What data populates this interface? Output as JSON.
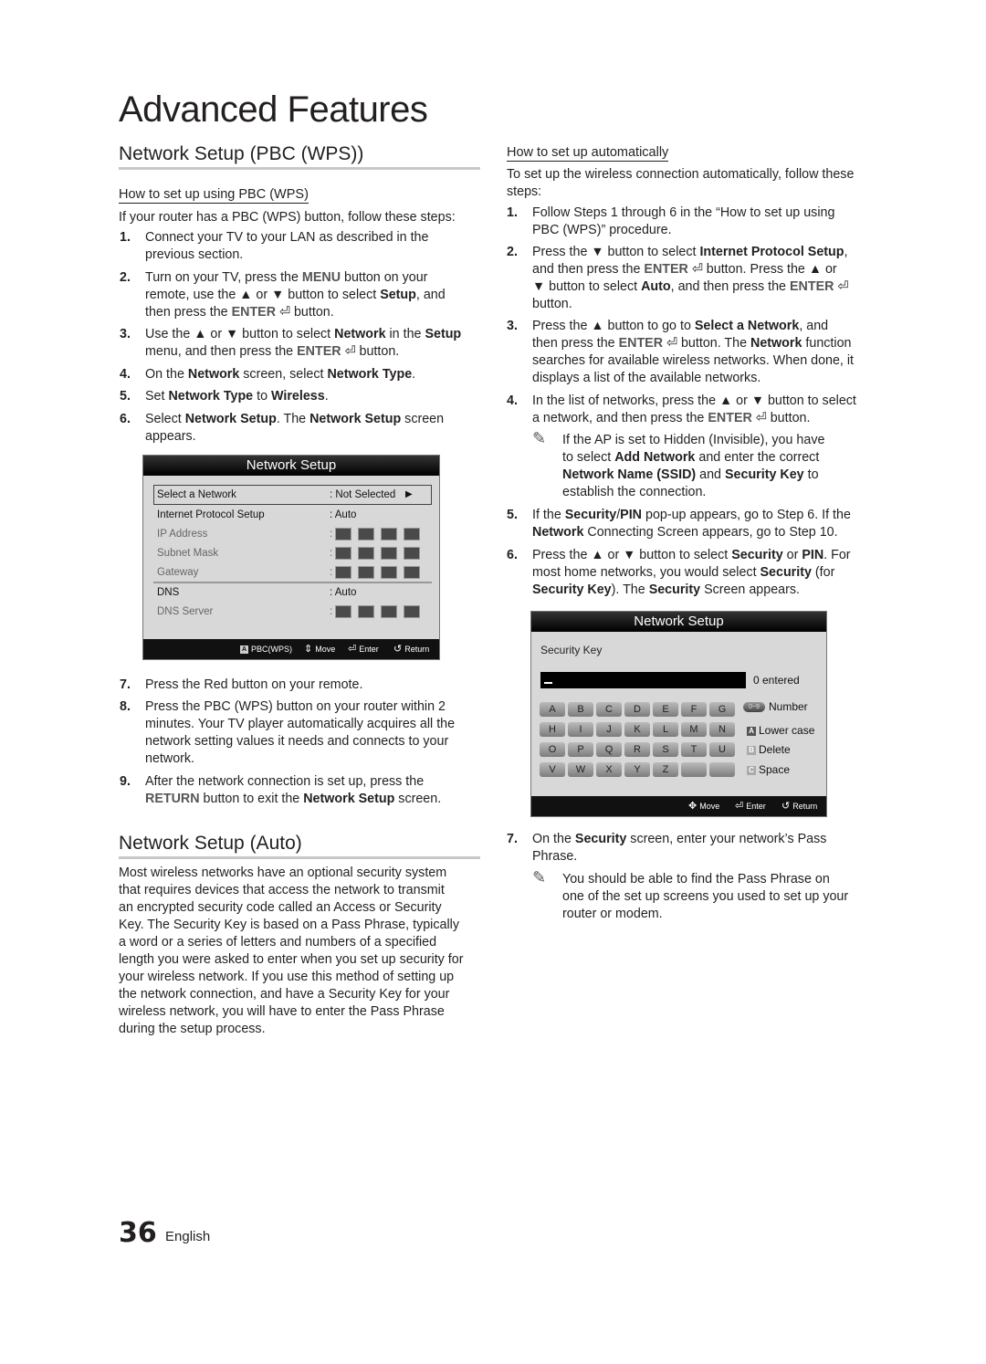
{
  "page": {
    "title": "Advanced Features",
    "number": "36",
    "language": "English"
  },
  "left": {
    "pbc_section": {
      "title": "Network Setup (PBC (WPS))",
      "subtitle": "How to set up using PBC (WPS)",
      "intro": "If your router has a PBC (WPS) button, follow these steps:",
      "steps": [
        {
          "num": "1.",
          "lines": [
            "Connect your TV to your LAN as described in the",
            "previous section."
          ]
        },
        {
          "num": "2.",
          "lines": [
            "Turn on your TV, press the MENU button on your",
            "remote, use the ▲ or ▼ button to select Setup, and",
            "then press the ENTER ⏎ button."
          ]
        },
        {
          "num": "3.",
          "lines": [
            "Use the ▲ or ▼ button to select Network in the Setup",
            "menu, and then press the ENTER ⏎ button."
          ]
        },
        {
          "num": "4.",
          "lines": [
            "On the Network screen, select Network Type."
          ]
        },
        {
          "num": "5.",
          "lines": [
            "Set Network Type to Wireless."
          ]
        },
        {
          "num": "6.",
          "lines": [
            "Select Network Setup. The Network Setup screen",
            "appears."
          ]
        },
        {
          "num": "7.",
          "lines": [
            "Press the Red button on your remote."
          ]
        },
        {
          "num": "8.",
          "lines": [
            "Press the PBC (WPS) button on your router within 2",
            "minutes. Your TV player automatically acquires all the",
            "network setting values it needs and connects to your",
            "network."
          ]
        },
        {
          "num": "9.",
          "lines": [
            "After the network connection is set up, press the",
            "RETURN button to exit the Network Setup screen."
          ]
        }
      ]
    },
    "screen1": {
      "title": "Network Setup",
      "rows": [
        {
          "label": "Select a Network",
          "value": ": Not Selected",
          "arrow": "▶",
          "selected": true,
          "dim": false
        },
        {
          "label": "Internet Protocol Setup",
          "value": ": Auto",
          "dim": false
        },
        {
          "label": "IP Address",
          "value": ":",
          "boxes": 4,
          "dim": true
        },
        {
          "label": "Subnet Mask",
          "value": ":",
          "boxes": 4,
          "dim": true
        },
        {
          "label": "Gateway",
          "value": ":",
          "boxes": 4,
          "dim": true
        },
        {
          "label": "DNS",
          "value": ": Auto",
          "dim": false
        },
        {
          "label": "DNS Server",
          "value": ":",
          "boxes": 4,
          "dim": true
        }
      ],
      "footer": [
        {
          "key": "A",
          "label": "PBC(WPS)"
        },
        {
          "icon": "up-down-arrow-icon",
          "glyph": "⇕",
          "label": "Move"
        },
        {
          "icon": "enter-icon",
          "glyph": "⏎",
          "label": "Enter"
        },
        {
          "icon": "return-icon",
          "glyph": "↺",
          "label": "Return"
        }
      ]
    },
    "auto_section": {
      "title": "Network Setup (Auto)",
      "body_lines": [
        "Most wireless networks have an optional security system",
        "that requires devices that access the network to transmit",
        "an encrypted security code called an Access or Security",
        "Key. The Security Key is based on a Pass Phrase, typically",
        "a word or a series of letters and numbers of a specified",
        "length you were asked to enter when you set up security for",
        "your wireless network.  If you use this method of setting up",
        "the network connection, and have a Security Key for your",
        "wireless network, you will have to enter the Pass Phrase",
        "during the setup process."
      ]
    }
  },
  "right": {
    "auto_howto": {
      "subtitle": "How to set up automatically",
      "intro_lines": [
        "To set up the wireless connection automatically, follow these",
        "steps:"
      ],
      "steps": [
        {
          "num": "1.",
          "lines": [
            "Follow Steps 1 through 6 in the “How to set up using",
            "PBC (WPS)” procedure."
          ]
        },
        {
          "num": "2.",
          "lines": [
            "Press the ▼ button to select Internet Protocol Setup,",
            "and then press the ENTER ⏎ button. Press the ▲ or",
            "▼ button to select Auto, and then press the ENTER ⏎",
            "button."
          ]
        },
        {
          "num": "3.",
          "lines": [
            "Press the ▲ button to go to Select a Network, and",
            "then press the ENTER ⏎ button. The Network function",
            "searches for available wireless networks. When done, it",
            "displays a list of the available networks."
          ]
        },
        {
          "num": "4.",
          "lines": [
            "In the list of networks, press the ▲ or ▼ button to select",
            "a network, and then press the ENTER ⏎ button."
          ]
        },
        {
          "num": "5.",
          "lines": [
            "If the Security/PIN pop-up appears, go to Step 6. If the",
            "Network Connecting Screen appears, go to Step 10."
          ]
        },
        {
          "num": "6.",
          "lines": [
            "Press the ▲ or ▼ button to select Security or PIN. For",
            "most home networks, you would select Security (for",
            "Security Key). The Security Screen appears."
          ]
        },
        {
          "num": "7.",
          "lines": [
            "On the Security screen, enter your network’s Pass",
            "Phrase."
          ]
        }
      ],
      "note_step4": [
        "If the AP is set to Hidden (Invisible), you have",
        "to select Add Network and enter the correct",
        "Network Name (SSID) and Security Key to",
        "establish the connection."
      ],
      "note_step7": [
        "You should be able to find the Pass Phrase on",
        "one of the set up screens you used to set up your",
        "router or modem."
      ]
    },
    "screen2": {
      "title": "Network Setup",
      "field_label": "Security Key",
      "input_value": "_",
      "entered_count": "0 entered",
      "keys": [
        [
          "A",
          "B",
          "C",
          "D",
          "E",
          "F",
          "G"
        ],
        [
          "H",
          "I",
          "J",
          "K",
          "L",
          "M",
          "N"
        ],
        [
          "O",
          "P",
          "Q",
          "R",
          "S",
          "T",
          "U"
        ],
        [
          "V",
          "W",
          "X",
          "Y",
          "Z",
          "",
          ""
        ]
      ],
      "legend": [
        {
          "key": "0~9",
          "label": "Number"
        },
        {
          "key": "A",
          "label": "Lower case"
        },
        {
          "key": "B",
          "label": "Delete"
        },
        {
          "key": "C",
          "label": "Space"
        }
      ],
      "footer": [
        {
          "icon": "four-way-arrow-icon",
          "glyph": "✥",
          "label": "Move"
        },
        {
          "icon": "enter-icon",
          "glyph": "⏎",
          "label": "Enter"
        },
        {
          "icon": "return-icon",
          "glyph": "↺",
          "label": "Return"
        }
      ]
    }
  }
}
